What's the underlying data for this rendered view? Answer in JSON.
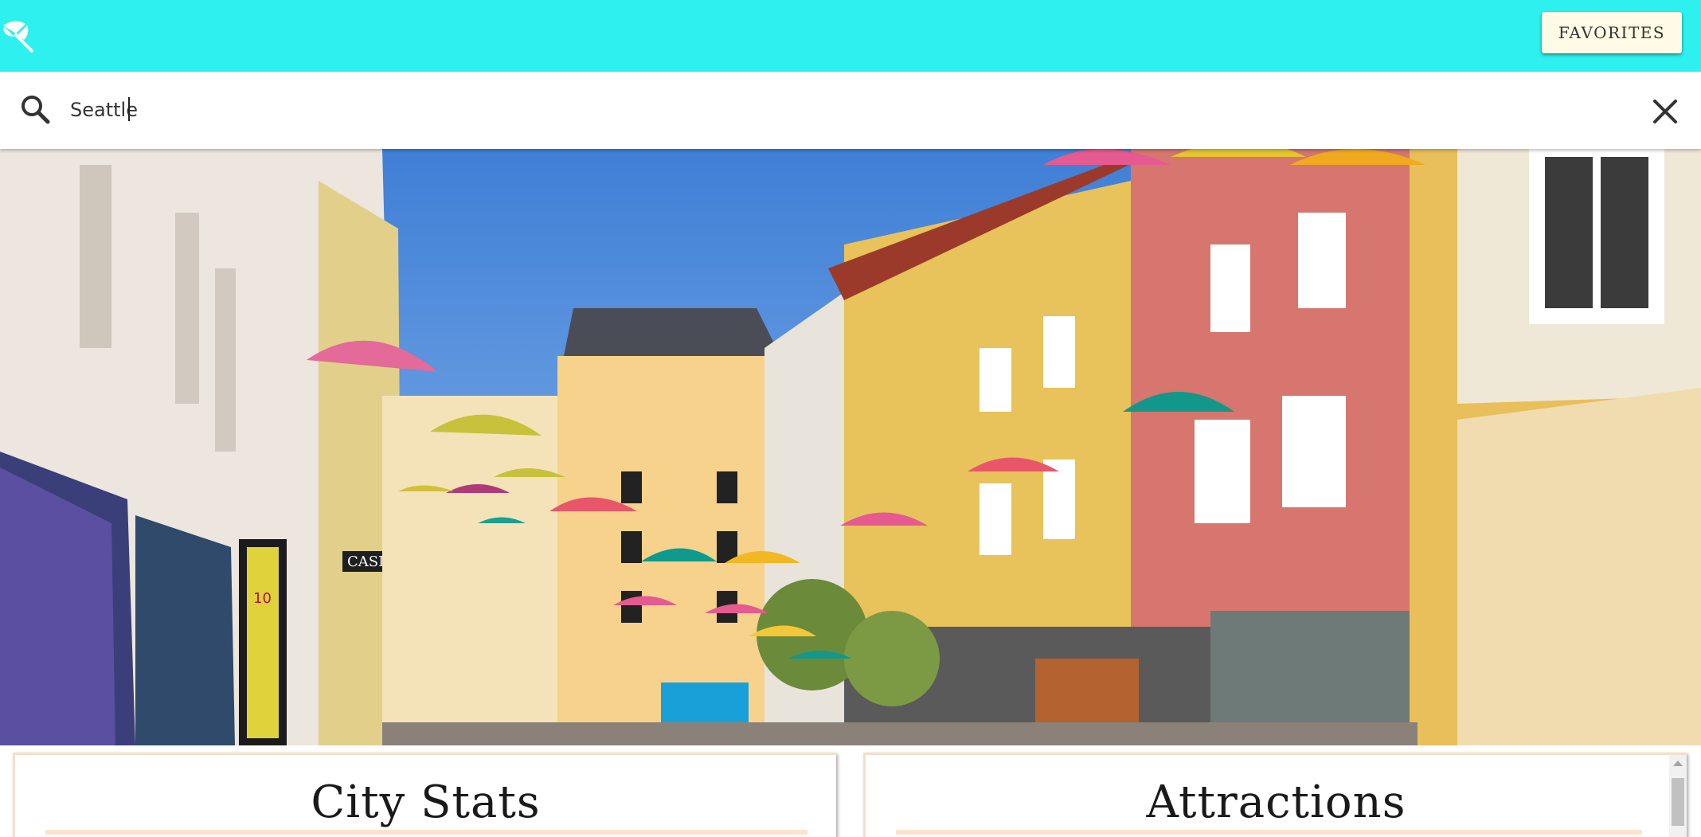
{
  "app": {
    "logo_icon": "umbrella-beach-icon",
    "accent_color": "#2ef0ee"
  },
  "header": {
    "favorites_label": "FAVORITES"
  },
  "search": {
    "value": "Seattle",
    "search_icon": "search-icon",
    "clear_icon": "close-icon"
  },
  "hero": {
    "shop_sign": "CASINO",
    "bus_stop_number": "10"
  },
  "cards": {
    "stats_title": "City Stats",
    "attractions_title": "Attractions"
  }
}
